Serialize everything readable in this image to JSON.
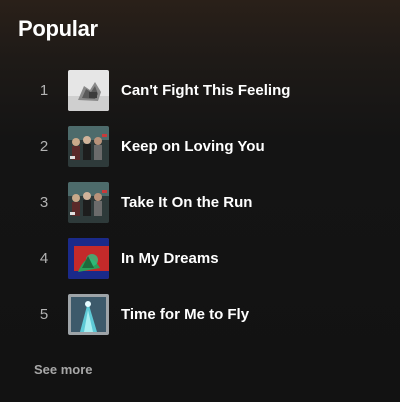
{
  "section": {
    "title": "Popular"
  },
  "tracks": [
    {
      "number": "1",
      "title": "Can't Fight This Feeling",
      "cover": "album-cover-silver"
    },
    {
      "number": "2",
      "title": "Keep on Loving You",
      "cover": "album-cover-band-photo"
    },
    {
      "number": "3",
      "title": "Take It On the Run",
      "cover": "album-cover-band-photo"
    },
    {
      "number": "4",
      "title": "In My Dreams",
      "cover": "album-cover-red-blue-art"
    },
    {
      "number": "5",
      "title": "Time for Me to Fly",
      "cover": "album-cover-cyan-art"
    }
  ],
  "footer": {
    "see_more_label": "See more"
  },
  "colors": {
    "background": "#121212",
    "header_tint": "#2a2019",
    "muted_text": "#b3b3b3"
  }
}
